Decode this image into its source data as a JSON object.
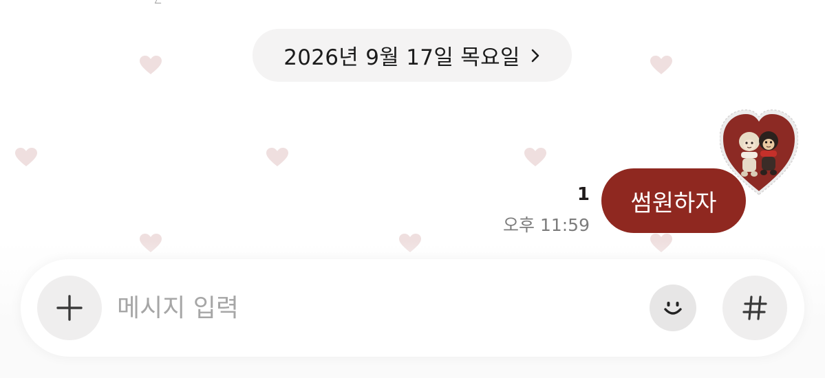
{
  "date_divider": {
    "label": "2026년 9월 17일 목요일",
    "chevron_icon": "chevron-right-icon"
  },
  "message": {
    "text": "썸원하자",
    "unread_count": "1",
    "time": "오후 11:59",
    "bubble_color": "#8f2820",
    "avatar": "heart-frame-avatar-two-plush-monkeys"
  },
  "composer": {
    "placeholder": "메시지 입력",
    "plus_icon": "plus-icon",
    "emoji_icon": "smiley-icon",
    "hash_icon": "hashtag-icon"
  },
  "theme": {
    "background": "#ffffff",
    "heart_pattern_color": "#eedede",
    "pill_background": "#f4f3f3"
  }
}
